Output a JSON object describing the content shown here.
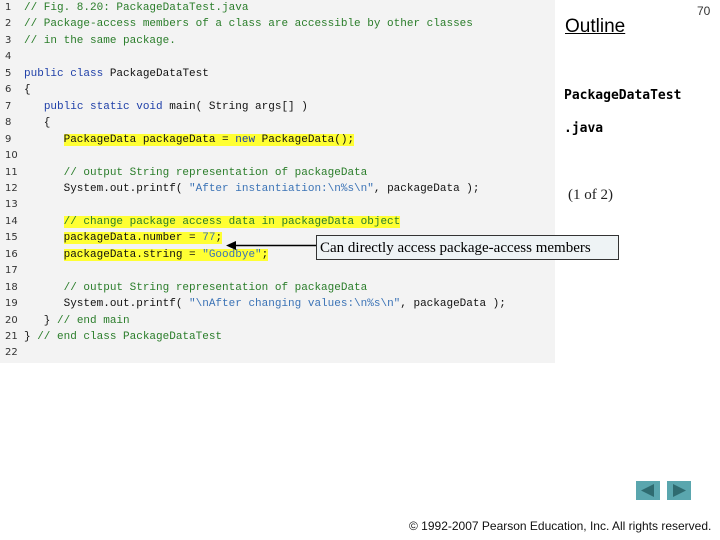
{
  "slide": {
    "page_number": "70",
    "outline_title": "Outline",
    "file_name_part1": "PackageDataTest",
    "file_name_part2": ".java",
    "part_label": "(1 of 2)",
    "callout": "Can directly access package-access members",
    "copyright": "© 1992-2007 Pearson Education, Inc.  All rights reserved.",
    "nav": {
      "prev": "previous-slide",
      "next": "next-slide"
    },
    "colors": {
      "highlight": "#ffff33",
      "comment": "#2a7d2a",
      "keyword": "#1e3fa8",
      "string": "#3b73b6",
      "nav": "#5aa6ae"
    }
  },
  "code": [
    {
      "n": "1",
      "seg": [
        [
          "c",
          "// Fig. 8.20: PackageDataTest.java"
        ]
      ]
    },
    {
      "n": "2",
      "seg": [
        [
          "c",
          "// Package-access members of a class are accessible by other classes"
        ]
      ]
    },
    {
      "n": "3",
      "seg": [
        [
          "c",
          "// in the same package."
        ]
      ]
    },
    {
      "n": "4",
      "seg": []
    },
    {
      "n": "5",
      "seg": [
        [
          "k",
          "public class "
        ],
        [
          "p",
          "PackageDataTest"
        ]
      ]
    },
    {
      "n": "6",
      "seg": [
        [
          "p",
          "{"
        ]
      ]
    },
    {
      "n": "7",
      "seg": [
        [
          "p",
          "   "
        ],
        [
          "k",
          "public static void "
        ],
        [
          "p",
          "main( String args[] )"
        ]
      ]
    },
    {
      "n": "8",
      "seg": [
        [
          "p",
          "   {"
        ]
      ]
    },
    {
      "n": "9",
      "hl": true,
      "seg": [
        [
          "p",
          "      "
        ],
        [
          "p",
          "PackageData packageData = "
        ],
        [
          "k",
          "new "
        ],
        [
          "p",
          "PackageData();"
        ]
      ]
    },
    {
      "n": "10",
      "seg": []
    },
    {
      "n": "11",
      "seg": [
        [
          "p",
          "      "
        ],
        [
          "c",
          "// output String representation of packageData"
        ]
      ]
    },
    {
      "n": "12",
      "seg": [
        [
          "p",
          "      System.out.printf( "
        ],
        [
          "s",
          "\"After instantiation:\\n%s\\n\""
        ],
        [
          "p",
          ", packageData );"
        ]
      ]
    },
    {
      "n": "13",
      "seg": []
    },
    {
      "n": "14",
      "hl": true,
      "seg": [
        [
          "p",
          "      "
        ],
        [
          "c",
          "// change package access data in packageData object"
        ]
      ]
    },
    {
      "n": "15",
      "hl": true,
      "seg": [
        [
          "p",
          "      "
        ],
        [
          "p",
          "packageData.number = "
        ],
        [
          "s",
          "77"
        ],
        [
          "p",
          ";"
        ]
      ]
    },
    {
      "n": "16",
      "hl": true,
      "seg": [
        [
          "p",
          "      "
        ],
        [
          "p",
          "packageData.string = "
        ],
        [
          "s",
          "\"Goodbye\""
        ],
        [
          "p",
          ";"
        ]
      ]
    },
    {
      "n": "17",
      "seg": []
    },
    {
      "n": "18",
      "seg": [
        [
          "p",
          "      "
        ],
        [
          "c",
          "// output String representation of packageData"
        ]
      ]
    },
    {
      "n": "19",
      "seg": [
        [
          "p",
          "      System.out.printf( "
        ],
        [
          "s",
          "\"\\nAfter changing values:\\n%s\\n\""
        ],
        [
          "p",
          ", packageData );"
        ]
      ]
    },
    {
      "n": "20",
      "seg": [
        [
          "p",
          "   } "
        ],
        [
          "c",
          "// end main"
        ]
      ]
    },
    {
      "n": "21",
      "seg": [
        [
          "p",
          "} "
        ],
        [
          "c",
          "// end class PackageDataTest"
        ]
      ]
    },
    {
      "n": "22",
      "seg": []
    }
  ]
}
